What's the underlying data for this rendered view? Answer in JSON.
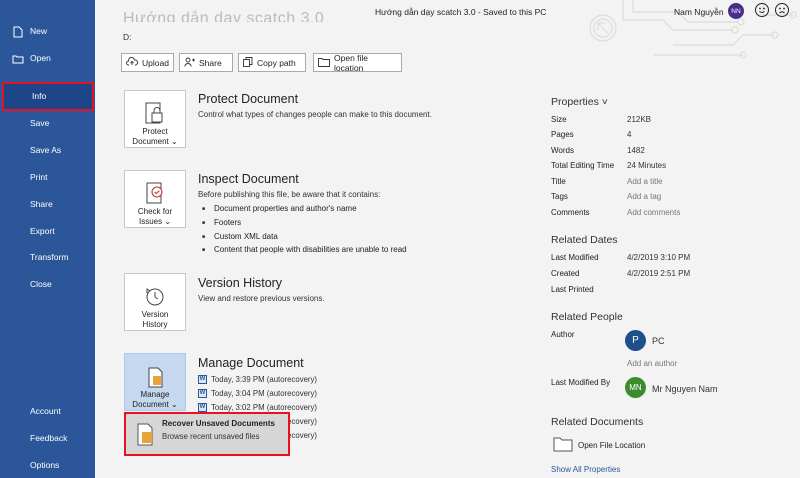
{
  "sidebar": {
    "top_items": [
      "New",
      "Open",
      "Info",
      "Save",
      "Save As",
      "Print",
      "Share",
      "Export",
      "Transform",
      "Close"
    ],
    "bottom_items": [
      "Account",
      "Feedback",
      "Options"
    ]
  },
  "window": {
    "title": "Hướng dẫn dạy scatch 3.0 - Saved to this PC",
    "user": "Nam Nguyễn",
    "user_initials": "NN"
  },
  "doc": {
    "title": "Hướng dẫn dạy scatch 3.0",
    "path": "D:"
  },
  "toolbar": {
    "upload": "Upload",
    "share": "Share",
    "copy_path": "Copy path",
    "open_location": "Open file location"
  },
  "protect": {
    "card_line1": "Protect",
    "card_line2": "Document",
    "heading": "Protect Document",
    "desc": "Control what types of changes people can make to this document."
  },
  "inspect": {
    "card_line1": "Check for",
    "card_line2": "Issues",
    "heading": "Inspect Document",
    "desc": "Before publishing this file, be aware that it contains:",
    "bullets": [
      "Document properties and author's name",
      "Footers",
      "Custom XML data",
      "Content that people with disabilities are unable to read"
    ]
  },
  "version": {
    "card_line1": "Version",
    "card_line2": "History",
    "heading": "Version History",
    "desc": "View and restore previous versions."
  },
  "manage": {
    "card_line1": "Manage",
    "card_line2": "Document",
    "heading": "Manage Document",
    "versions": [
      "Today, 3:39 PM (autorecovery)",
      "Today, 3:04 PM (autorecovery)",
      "Today, 3:02 PM (autorecovery)",
      "Today, 2:59 PM (autorecovery)",
      "Today, 2:56 PM (autorecovery)"
    ]
  },
  "popup": {
    "title": "Recover Unsaved Documents",
    "subtitle": "Browse recent unsaved files"
  },
  "properties": {
    "heading": "Properties",
    "rows": [
      {
        "label": "Size",
        "value": "212KB"
      },
      {
        "label": "Pages",
        "value": "4"
      },
      {
        "label": "Words",
        "value": "1482"
      },
      {
        "label": "Total Editing Time",
        "value": "24 Minutes"
      },
      {
        "label": "Title",
        "value": "Add a title"
      },
      {
        "label": "Tags",
        "value": "Add a tag"
      },
      {
        "label": "Comments",
        "value": "Add comments"
      }
    ]
  },
  "dates": {
    "heading": "Related Dates",
    "rows": [
      {
        "label": "Last Modified",
        "value": "4/2/2019 3:10 PM"
      },
      {
        "label": "Created",
        "value": "4/2/2019 2:51 PM"
      },
      {
        "label": "Last Printed",
        "value": ""
      }
    ]
  },
  "people": {
    "heading": "Related People",
    "author_label": "Author",
    "author_initial": "P",
    "author_name": "PC",
    "add_author": "Add an author",
    "modified_label": "Last Modified By",
    "modified_initials": "MN",
    "modified_name": "Mr Nguyen Nam"
  },
  "related_docs": {
    "heading": "Related Documents",
    "open_location": "Open File Location",
    "show_all": "Show All Properties"
  },
  "colors": {
    "sidebar": "#2b579a",
    "highlight": "#e81123",
    "author_avatar": "#1f4e8c",
    "modifier_avatar": "#3d8b2f",
    "user_avatar": "#4a2c8c"
  }
}
